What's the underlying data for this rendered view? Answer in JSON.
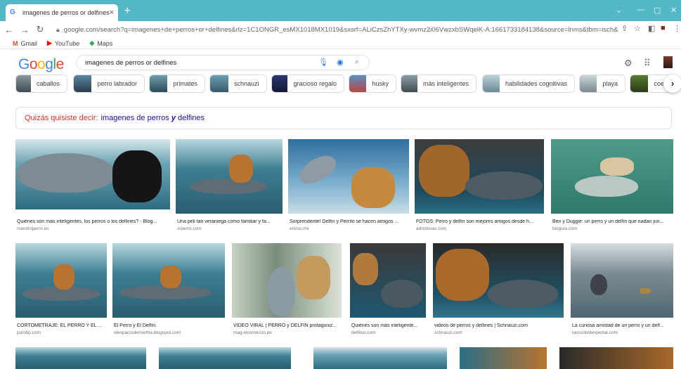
{
  "browser": {
    "tab_title": "imagenes de perros or delfines -",
    "tab_close": "×",
    "new_tab": "+",
    "url": "google.com/search?q=imagenes+de+perros+or+delfines&rlz=1C1ONGR_esMX1018MX1019&sxsrf=ALiCzsZhYTXy-wvmz2i06VwzxbSWqelK-A:1661733184138&source=lnms&tbm=isch&sa=X&ved=2ahUK...",
    "bookmarks": [
      {
        "icon": "M",
        "label": "Gmail",
        "color": "#ea4335"
      },
      {
        "icon": "▶",
        "label": "YouTube",
        "color": "#ff0000"
      },
      {
        "icon": "◆",
        "label": "Maps",
        "color": "#34a853"
      }
    ]
  },
  "google": {
    "logo": [
      "G",
      "o",
      "o",
      "g",
      "l",
      "e"
    ],
    "logo_colors": [
      "#4285f4",
      "#ea4335",
      "#fbbc05",
      "#4285f4",
      "#34a853",
      "#ea4335"
    ],
    "query": "imagenes de perros or delfines",
    "chips": [
      "caballos",
      "perro labrador",
      "primates",
      "schnauzi",
      "gracioso regalo",
      "husky",
      "más inteligentes",
      "habilidades cognitivas",
      "playa",
      "coe"
    ],
    "did_you_mean_label": "Quizás quisiste decir:",
    "did_you_mean_pre": "imagenes de perros",
    "did_you_mean_bold": "y",
    "did_you_mean_post": "delfines"
  },
  "results": [
    {
      "caption": "Quiénes son más inteligentes, los perros o los delfines? - Blog...",
      "source": "nuestroperro.es"
    },
    {
      "caption": "Una peli tan veraniega como familiar y fa...",
      "source": "srperro.com"
    },
    {
      "caption": "Sorprendente! Delfín y Perrito se hacen amigos ...",
      "source": "erizos.mx"
    },
    {
      "caption": "FOTOS: Perro y delfín son mejores amigos desde h...",
      "source": "adnoticias.com"
    },
    {
      "caption": "Ben y Duggie: un perro y un delfín que nadan jun...",
      "source": "bioguia.com"
    },
    {
      "caption": "CORTOMETRAJE: EL PERRO Y EL ...",
      "source": "purotip.com"
    },
    {
      "caption": "El Perro y El Delfín.",
      "source": "elespaciodemartha.blogspot.com"
    },
    {
      "caption": "VIDEO VIRAL | PERRO y DELFÍN protagoniz...",
      "source": "mag.elcomercio.pe"
    },
    {
      "caption": "Quiénes son más inteligente...",
      "source": "delfinio.com"
    },
    {
      "caption": "videos de perros y delfines | Schnauzi.com",
      "source": "schnauzi.com"
    },
    {
      "caption": "La curiosa amistad de un perro y un delf...",
      "source": "lavozdeldespertar.com"
    }
  ]
}
